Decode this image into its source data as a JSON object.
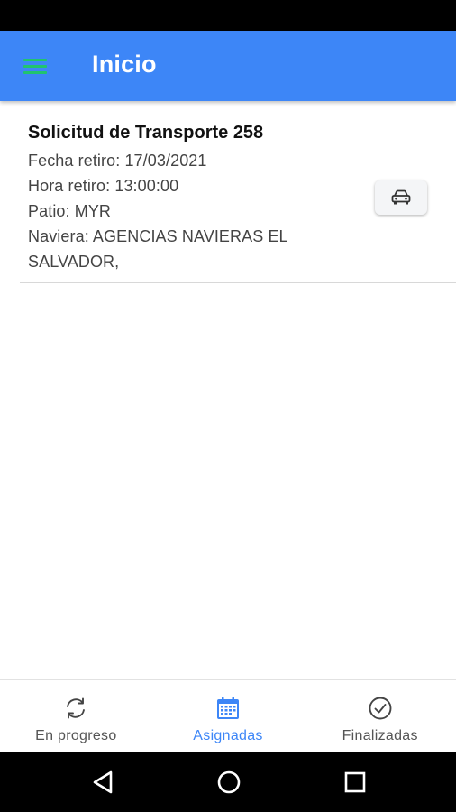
{
  "app_bar": {
    "title": "Inicio",
    "menu_icon": "hamburger-menu-icon",
    "color": "#3d86f7",
    "menu_icon_color": "#21c46f"
  },
  "request_card": {
    "title": "Solicitud de Transporte 258",
    "lines": [
      "Fecha retiro: 17/03/2021",
      "Hora retiro: 13:00:00",
      "Patio: MYR",
      "Naviera: AGENCIAS NAVIERAS EL",
      "SALVADOR,"
    ],
    "action_icon": "car-icon"
  },
  "bottom_nav": {
    "active_color": "#3d86f7",
    "items": [
      {
        "label": "En progreso",
        "icon": "refresh-icon",
        "active": false
      },
      {
        "label": "Asignadas",
        "icon": "calendar-icon",
        "active": true
      },
      {
        "label": "Finalizadas",
        "icon": "check-circle-icon",
        "active": false
      }
    ]
  },
  "system_nav": {
    "buttons": [
      "back-icon",
      "home-icon",
      "recent-apps-icon"
    ]
  }
}
